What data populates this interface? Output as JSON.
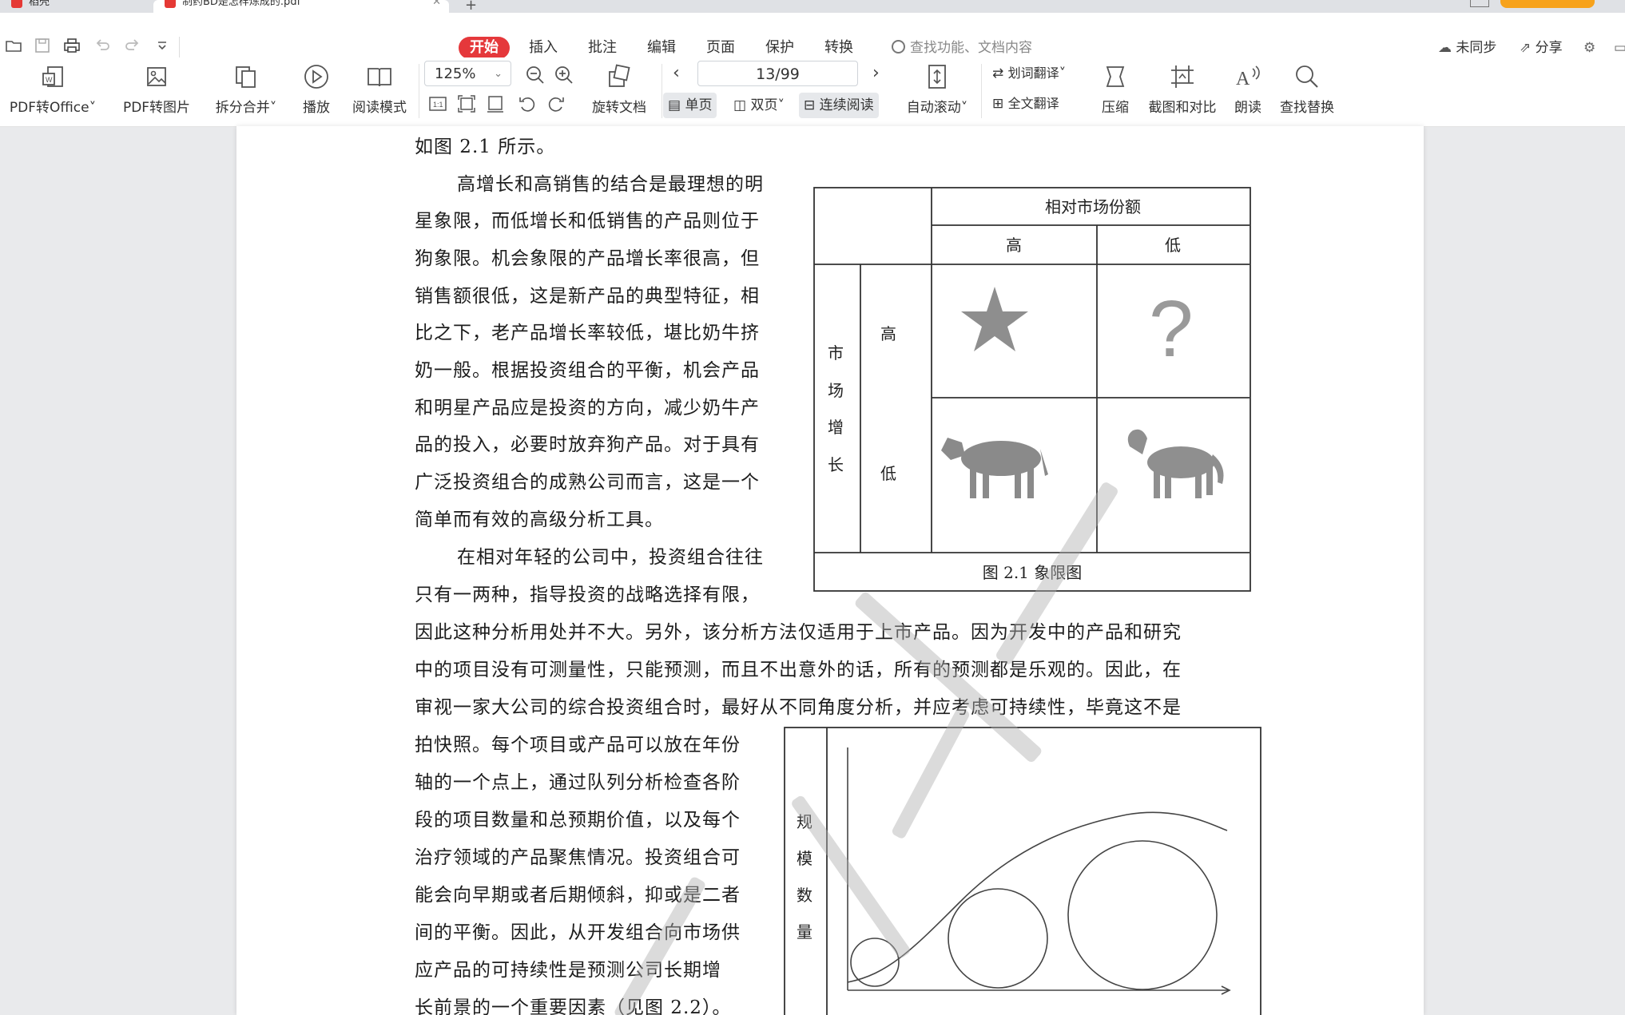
{
  "tabs": [
    {
      "label": "稻壳"
    },
    {
      "label": "制药BD是怎样炼成的.pdf"
    }
  ],
  "menubar": {
    "items": [
      "开始",
      "插入",
      "批注",
      "编辑",
      "页面",
      "保护",
      "转换"
    ],
    "active": "开始",
    "search_placeholder": "查找功能、文档内容",
    "sync_label": "未同步",
    "share_label": "分享"
  },
  "ribbon": {
    "pdf_to_office": "PDF转Office",
    "pdf_to_image": "PDF转图片",
    "split_merge": "拆分合并",
    "play": "播放",
    "read_mode": "阅读模式",
    "zoom_value": "125%",
    "rotate_doc": "旋转文档",
    "page_indicator": "13/99",
    "single_page": "单页",
    "double_page": "双页",
    "continuous_read": "连续阅读",
    "auto_scroll": "自动滚动",
    "word_translate": "划词翻译",
    "full_translate": "全文翻译",
    "compress": "压缩",
    "screenshot_compare": "截图和对比",
    "read_aloud": "朗读",
    "find_replace": "查找替换"
  },
  "document": {
    "lines_left": [
      "如图 2.1 所示。",
      "高增长和高销售的结合是最理想的明",
      "星象限，而低增长和低销售的产品则位于",
      "狗象限。机会象限的产品增长率很高，但",
      "销售额很低，这是新产品的典型特征，相",
      "比之下，老产品增长率较低，堪比奶牛挤",
      "奶一般。根据投资组合的平衡，机会产品",
      "和明星产品应是投资的方向，减少奶牛产",
      "品的投入，必要时放弃狗产品。对于具有",
      "广泛投资组合的成熟公司而言，这是一个",
      "简单而有效的高级分析工具。",
      "在相对年轻的公司中，投资组合往往",
      "只有一两种，指导投资的战略选择有限，"
    ],
    "lines_full": [
      "因此这种分析用处并不大。另外，该分析方法仅适用于上市产品。因为开发中的产品和研究",
      "中的项目没有可测量性，只能预测，而且不出意外的话，所有的预测都是乐观的。因此，在",
      "审视一家大公司的综合投资组合时，最好从不同角度分析，并应考虑可持续性，毕竟这不是"
    ],
    "lines_left2": [
      "拍快照。每个项目或产品可以放在年份",
      "轴的一个点上，通过队列分析检查各阶",
      "段的项目数量和总预期价值，以及每个",
      "治疗领域的产品聚焦情况。投资组合可",
      "能会向早期或者后期倾斜，抑或是二者",
      "间的平衡。因此，从开发组合向市场供",
      "应产品的可持续性是预测公司长期增",
      "长前景的一个重要因素（见图 2.2）。"
    ]
  },
  "figure1": {
    "col_header": "相对市场份额",
    "col_high": "高",
    "col_low": "低",
    "row_header_chars": [
      "市",
      "场",
      "增",
      "长"
    ],
    "row_high": "高",
    "row_low": "低",
    "cells": [
      "star-icon",
      "question-icon",
      "cow-icon",
      "dog-icon"
    ],
    "caption": "图 2.1  象限图"
  },
  "figure2": {
    "ylabel_chars": [
      "规",
      "模",
      "数",
      "量"
    ]
  }
}
